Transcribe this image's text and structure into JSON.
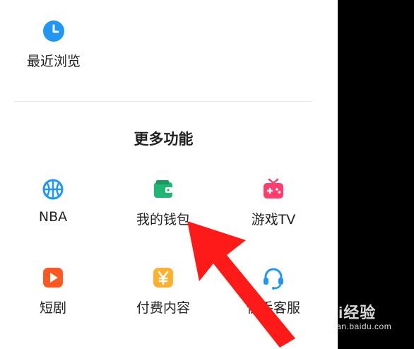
{
  "recent": {
    "label": "最近浏览",
    "icon": "clock-icon"
  },
  "more_section": {
    "title": "更多功能"
  },
  "features": [
    {
      "label": "NBA",
      "icon": "basketball-icon"
    },
    {
      "label": "我的钱包",
      "icon": "wallet-icon"
    },
    {
      "label": "游戏TV",
      "icon": "game-tv-icon"
    },
    {
      "label": "短剧",
      "icon": "play-icon"
    },
    {
      "label": "付费内容",
      "icon": "yen-icon"
    },
    {
      "label": "快手客服",
      "icon": "headset-icon"
    }
  ],
  "annotation": {
    "icon": "red-arrow-icon"
  },
  "watermark": {
    "brand": "Bai经验",
    "url": "jingyan.baidu.com"
  },
  "colors": {
    "blue": "#2196f3",
    "green": "#22b573",
    "pink": "#ff3d6e",
    "orange": "#ff5722",
    "yellow": "#ffb02e",
    "arrow": "#ff1a1a"
  }
}
